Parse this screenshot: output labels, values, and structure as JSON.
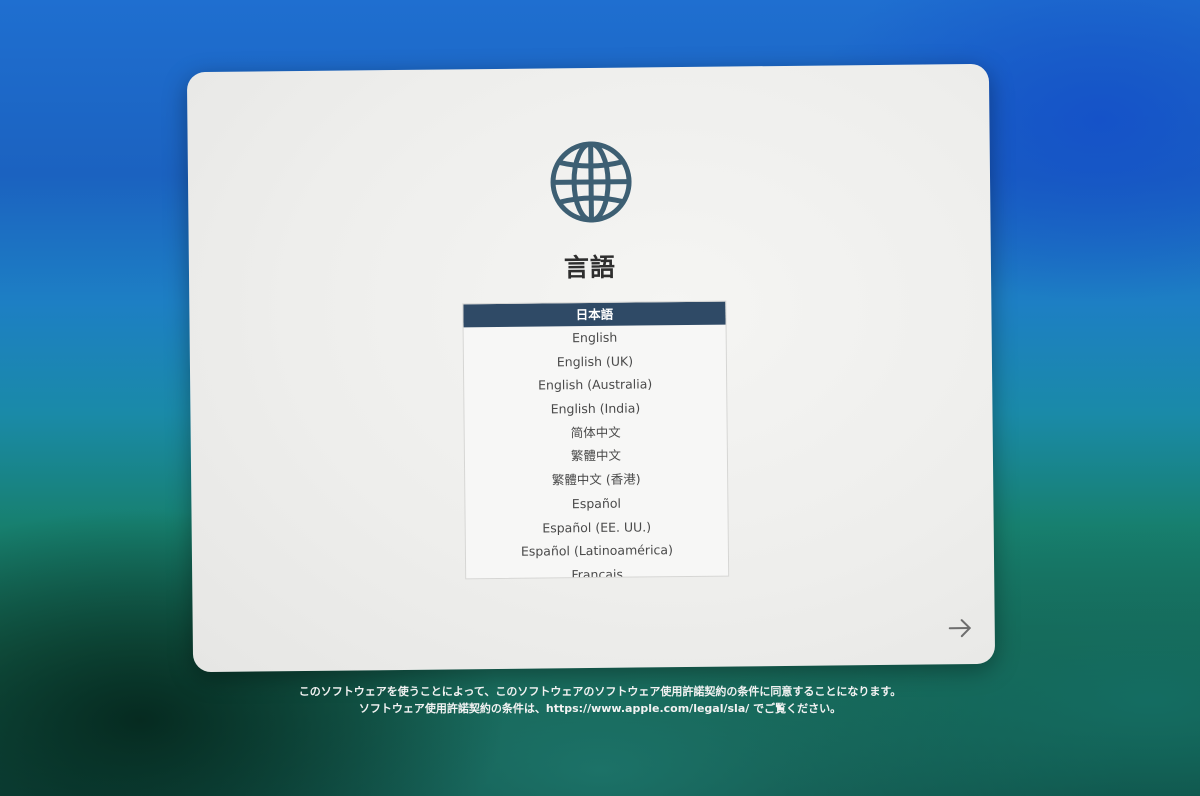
{
  "setup": {
    "title": "言語",
    "icon": "globe-icon",
    "languages": [
      "日本語",
      "English",
      "English (UK)",
      "English (Australia)",
      "English (India)",
      "简体中文",
      "繁體中文",
      "繁體中文 (香港)",
      "Español",
      "Español (EE. UU.)",
      "Español (Latinoamérica)",
      "Français"
    ],
    "selected_language": "日本語",
    "next_icon": "right-arrow-icon"
  },
  "legal": {
    "line1": "このソフトウェアを使うことによって、このソフトウェアのソフトウェア使用許諾契約の条件に同意することになります。",
    "line2": "ソフトウェア使用許諾契約の条件は、https://www.apple.com/legal/sla/ でご覧ください。"
  },
  "colors": {
    "selection": "#2f4a66",
    "globe": "#3d5f73",
    "window": "#efefed"
  }
}
